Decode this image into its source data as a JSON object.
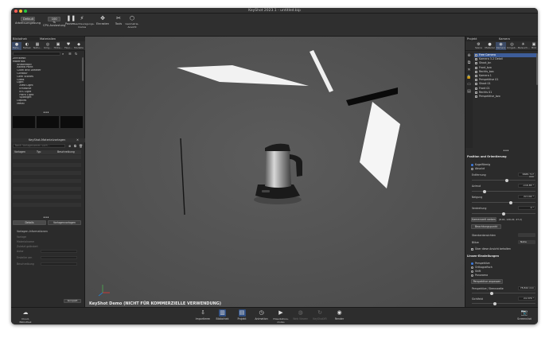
{
  "window": {
    "title": "KeyShot 2023.1 - untitled.bip",
    "traffic_colors": [
      "#ff5f57",
      "#febc2e",
      "#28c840"
    ]
  },
  "toolbar": {
    "workspace_value": "Default",
    "workspace_label": "Arbeitsumgebung",
    "cpu_value": "100 %",
    "cpu_label": "CPU-Auslastung",
    "pause_label": "Pause",
    "buttons": [
      {
        "label": "Beschleunigungs-\nmodus",
        "icon": "lightning-icon"
      },
      {
        "label": "Einrasten",
        "icon": "magnet-icon"
      },
      {
        "label": "Tools",
        "icon": "tools-icon"
      },
      {
        "label": "Geometrie-\nAnsicht",
        "icon": "geometry-icon"
      }
    ]
  },
  "left_panel": {
    "header_library": "Bibliothek",
    "header_materials": "Materialien",
    "tabs": [
      "Mate...",
      "Farben",
      "Textu...",
      "Umg...",
      "Hinte...",
      "Favo...",
      "Modelle"
    ],
    "tree_items": [
      "Zinnkiesit",
      "Materials",
      "  Anisotropic",
      "  Axalta Paint",
      "  Cloth and Leather",
      "  Contour",
      "  Gem Stones",
      "  Glass",
      "  Light",
      "    Area Light",
      "    Emissive",
      "    IES Light",
      "    Point Light",
      "    Spotlight",
      "  Liquids",
      "  Metal"
    ],
    "templates_header": "KeyShot-Materialvorlagen",
    "search_placeholder": "Nach Vorlagenamen such...",
    "table_headers": [
      "Vorlagen",
      "Typ",
      "Beschreibung"
    ],
    "details_btn": "Details",
    "templates_btn": "Vorlagenvorlagen",
    "template_info_title": "Vorlagen-Informationen",
    "props": [
      "Vorlage",
      "Materialname",
      "Zuletzt geändert",
      "Autor",
      "Ersteller am",
      "Beschreibung"
    ],
    "mode_select": "Komplett"
  },
  "viewport": {
    "watermark": "KeyShot Demo (NICHT FÜR KOMMERZIELLE VERWENDUNG)"
  },
  "right_panel": {
    "header_project": "Projekt",
    "header_camera": "Kamera",
    "tabs": [
      "Szene",
      "Material",
      "Kamera",
      "Umgeb...",
      "Beleuch...",
      "Bild"
    ],
    "cameras": [
      "Free Camera",
      "Kamera 3-2 Detail",
      "Shoot_bn",
      "Front_bzo",
      "Rechts_bzo",
      "Kamera 1",
      "Perspektive 01",
      "Shoot 01",
      "Front 01",
      "Rechts 01",
      "Perspektive_bzo"
    ],
    "section_position": "Position und Orientierung",
    "radio_relative": "Kugelförmig",
    "radio_absolute": "Absolut",
    "distance_label": "Entfernung",
    "distance_value": "6665.717 mm",
    "distance_pct": 0.55,
    "azimuth_label": "Azimut",
    "azimuth_value": "-116.85 °",
    "azimuth_pct": 0.18,
    "incline_label": "Neigung",
    "incline_value": "22.102 °",
    "incline_pct": 0.62,
    "twist_label": "Verdrehung",
    "twist_value": "0 °",
    "twist_pct": 0.5,
    "camera_pos_btn": "Kamerazeit weben",
    "coords_text": "(8.01, 126.22, 47.2)",
    "focus_btn": "Beachtungspunkt",
    "standard_label": "Standardansichten",
    "view_label": "Blitze",
    "view_select": "Nahe",
    "lock_label": "Über diese Ansicht behalten",
    "section_lens": "Linsen-Einstellungen",
    "lens_options": [
      "Perspektive",
      "Orthografisch",
      "Shift",
      "Panorama"
    ],
    "lens_btn": "Perspektive anpassen",
    "persp_label": "Perspektive / Brennweite",
    "persp_value": "78.844 mm",
    "persp_pct": 0.3,
    "fov_label": "Sichtfeld",
    "fov_value": "24.376 °",
    "fov_pct": 0.35
  },
  "bottom_bar": {
    "cloud_label": "Cloud-Bibliothek",
    "buttons": [
      {
        "label": "Importieren",
        "icon": "import-icon",
        "active": false,
        "dim": false
      },
      {
        "label": "Bibliothek",
        "icon": "library-icon",
        "active": true,
        "dim": false
      },
      {
        "label": "Projekt",
        "icon": "project-icon",
        "active": true,
        "dim": false
      },
      {
        "label": "Animation",
        "icon": "animation-icon",
        "active": false,
        "dim": false
      },
      {
        "label": "Präsentations-modus",
        "icon": "presentation-icon",
        "active": false,
        "dim": false
      },
      {
        "label": "Web Viewer",
        "icon": "web-icon",
        "active": false,
        "dim": true
      },
      {
        "label": "KeyShotXR",
        "icon": "xr-icon",
        "active": false,
        "dim": true
      },
      {
        "label": "Render",
        "icon": "render-icon",
        "active": false,
        "dim": false
      }
    ],
    "screenshot_label": "Screenshot"
  }
}
